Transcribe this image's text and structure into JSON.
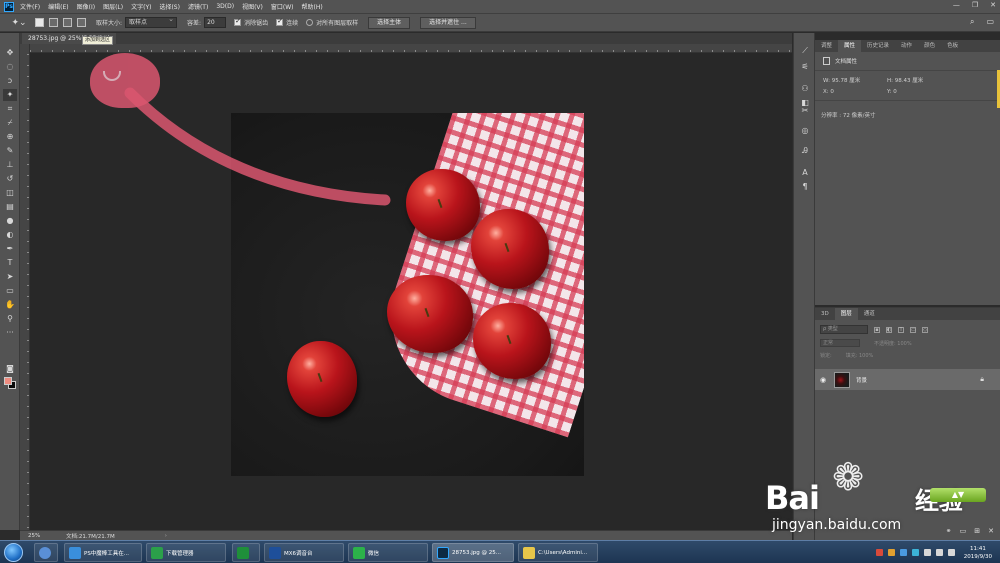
{
  "app": {
    "logo": "Ps",
    "menu": [
      "文件(F)",
      "编辑(E)",
      "图像(I)",
      "图层(L)",
      "文字(Y)",
      "选择(S)",
      "滤镜(T)",
      "3D(D)",
      "视图(V)",
      "窗口(W)",
      "帮助(H)"
    ],
    "window_controls": [
      "—",
      "❐",
      "✕"
    ]
  },
  "options": {
    "tool_preset_icon": "magic-wand-icon",
    "sample_size_label": "取样大小:",
    "sample_size_value": "取样点",
    "tolerance_label": "容差:",
    "tolerance_value": "20",
    "anti_alias_label": "消除锯齿",
    "anti_alias_checked": true,
    "contiguous_label": "连续",
    "contiguous_checked": true,
    "sample_all_label": "对所有图层取样",
    "sample_all_checked": false,
    "select_subject_label": "选择主体",
    "select_mask_label": "选择并遮住 ...",
    "tooltip": "添加到选区"
  },
  "document": {
    "tab_title": "28753.jpg @ 25%(RGB/8#)",
    "zoom": "25%",
    "doc_size": "文档:21.7M/21.7M"
  },
  "properties_panel": {
    "tabs": [
      "调整",
      "属性",
      "历史记录",
      "动作",
      "颜色",
      "色板"
    ],
    "active_tab": "属性",
    "section_title": "文档属性",
    "w_label": "W:",
    "w_value": "95.78 厘米",
    "h_label": "H:",
    "h_value": "98.43 厘米",
    "x_label": "X:",
    "x_value": "0",
    "y_label": "Y:",
    "y_value": "0",
    "resolution": "分辨率 : 72 像素/英寸"
  },
  "layers_panel": {
    "tabs": [
      "3D",
      "图层",
      "通道"
    ],
    "active_tab": "图层",
    "kind_placeholder": "ρ 类型",
    "blend_mode": "正常",
    "opacity_label": "不透明度:",
    "opacity_value": "100%",
    "lock_label": "锁定:",
    "fill_label": "填充:",
    "fill_value": "100%",
    "layer_name": "背景"
  },
  "watermark": {
    "brand": "Bai",
    "brand_cn": "经验",
    "url": "jingyan.baidu.com"
  },
  "taskbar": {
    "tasks": [
      {
        "label": "PS中魔棒工具在...",
        "color": "#3a8fdc"
      },
      {
        "label": "下载管理器",
        "color": "#2ba04a"
      },
      {
        "label": "",
        "color": "#1f8f3a"
      },
      {
        "label": "MX6调音台",
        "color": "#1e4f9a"
      },
      {
        "label": "微信",
        "color": "#2cb24a"
      },
      {
        "label": "28753.jpg @ 25...",
        "color": "#0d2a44"
      },
      {
        "label": "C:\\Users\\Admini...",
        "color": "#e7c64a"
      }
    ],
    "time": "11:41",
    "date": "2019/9/30"
  },
  "colors": {
    "foreground": "#ef8c80",
    "background": "#0a0a0a",
    "ui_panel": "#535353"
  }
}
